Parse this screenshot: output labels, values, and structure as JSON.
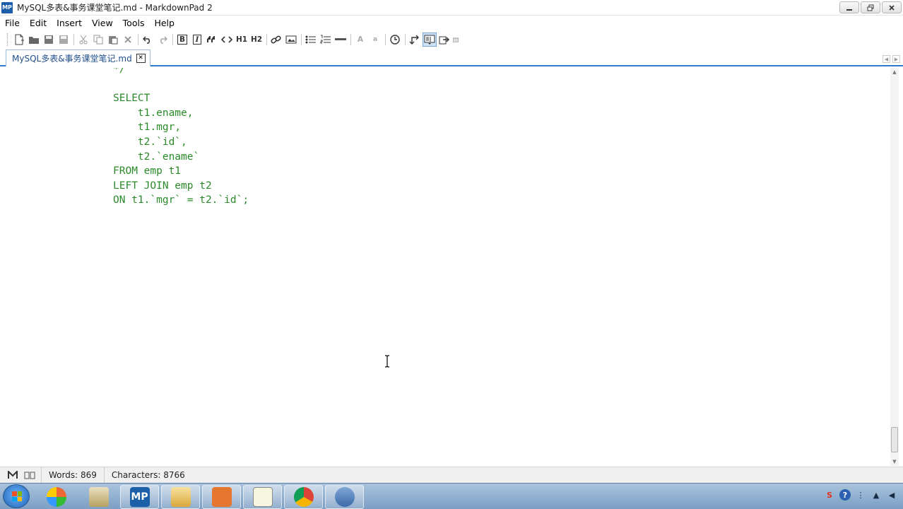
{
  "window": {
    "title": "MySQL多表&事务课堂笔记.md - MarkdownPad 2",
    "app_icon_label": "MP",
    "controls": [
      "minimize",
      "restore",
      "close"
    ]
  },
  "menu": [
    "File",
    "Edit",
    "Insert",
    "View",
    "Tools",
    "Help"
  ],
  "toolbar": {
    "text_buttons": {
      "bold": "B",
      "italic": "I",
      "h1": "H1",
      "h2": "H2",
      "font_large": "A",
      "font_small": "a"
    }
  },
  "tab": {
    "label": "MySQL多表&事务课堂笔记.md",
    "close_glyph": "✕"
  },
  "editor": {
    "lines": [
      "*/",
      "",
      "SELECT",
      "    t1.ename,",
      "    t1.mgr,",
      "    t2.`id`,",
      "    t2.`ename`",
      "FROM emp t1",
      "LEFT JOIN emp t2",
      "ON t1.`mgr` = t2.`id`;"
    ],
    "text_color": "#2a8a2a"
  },
  "status": {
    "words": "Words: 869",
    "characters": "Characters: 8766"
  },
  "taskbar": {
    "apps": [
      "start",
      "windows-explorer-color",
      "paint-brush",
      "markdownpad",
      "file-explorer",
      "pdf-reader",
      "chart-tool",
      "chrome",
      "mysql-dolphin"
    ],
    "active_app": "markdownpad"
  }
}
